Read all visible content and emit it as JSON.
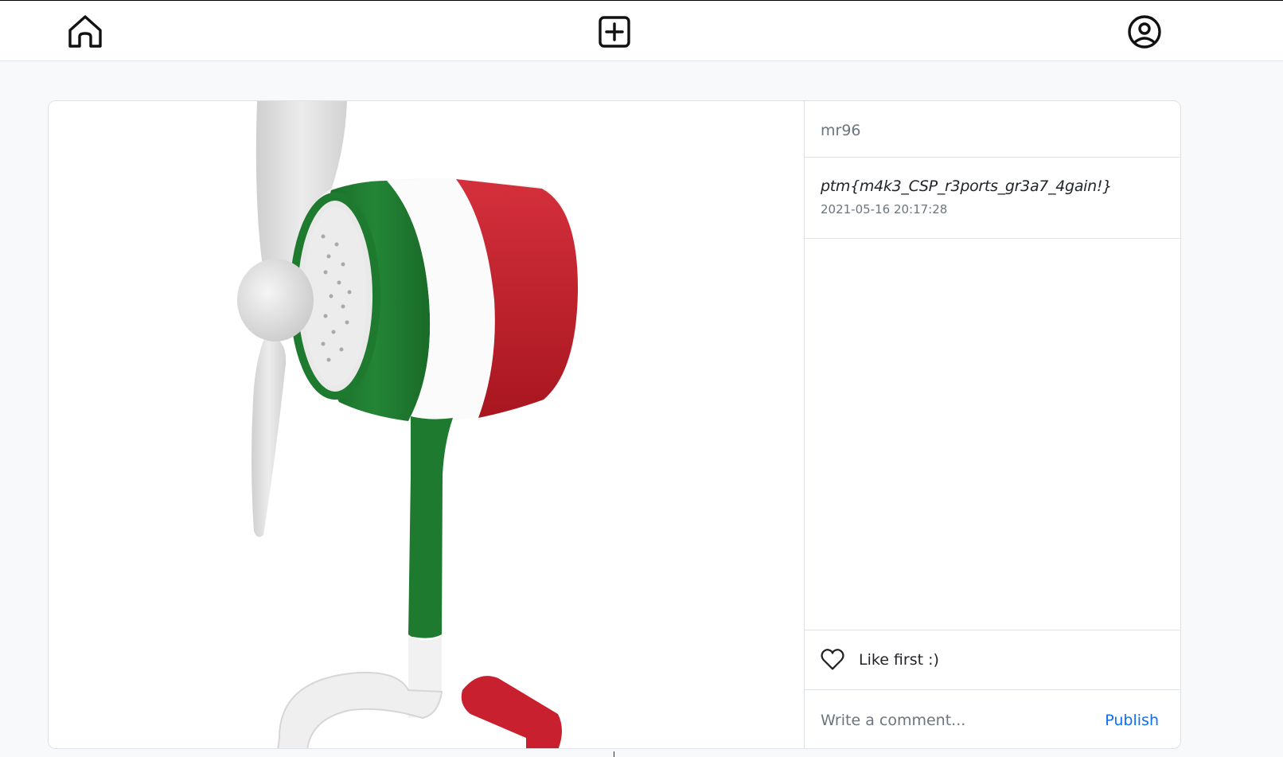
{
  "navbar": {
    "home_icon": "home-icon",
    "new_post_icon": "plus-square-icon",
    "profile_icon": "user-circle-icon"
  },
  "post": {
    "author": "mr96",
    "caption": "ptm{m4k3_CSP_r3ports_gr3a7_4gain!}",
    "date": "2021-05-16 20:17:28",
    "photo_description": "desk-fan-italian-flag-colors",
    "like_icon": "heart-outline-icon",
    "like_text": "Like first :)",
    "comment_placeholder": "Write a comment...",
    "publish_label": "Publish"
  },
  "colors": {
    "accent": "#0d6efd",
    "muted": "#6c757d",
    "flag_green": "#1e7a2e",
    "flag_white": "#ffffff",
    "flag_red": "#c8202e"
  }
}
